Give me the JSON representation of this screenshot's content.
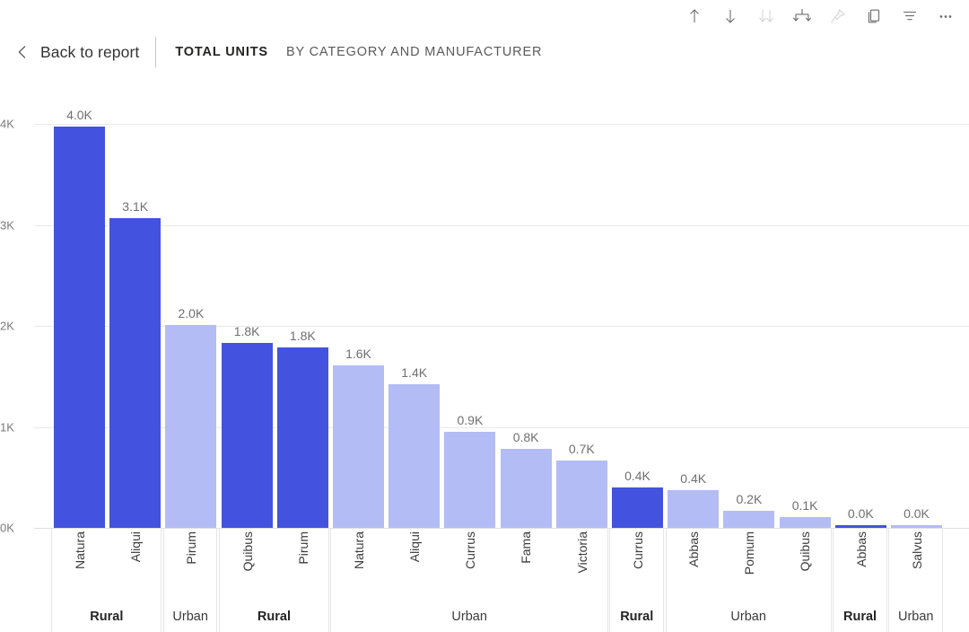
{
  "toolbar": {
    "buttons": [
      {
        "name": "sort-ascending-icon",
        "label": "Sort ascending",
        "dim": false
      },
      {
        "name": "sort-descending-icon",
        "label": "Sort descending",
        "dim": false
      },
      {
        "name": "drill-down-icon",
        "label": "Drill down",
        "dim": true
      },
      {
        "name": "expand-all-icon",
        "label": "Expand all down one level",
        "dim": false
      },
      {
        "name": "pin-icon",
        "label": "Pin visual",
        "dim": true
      },
      {
        "name": "copy-icon",
        "label": "Copy visual",
        "dim": false
      },
      {
        "name": "filter-icon",
        "label": "Filters",
        "dim": false
      },
      {
        "name": "more-options-icon",
        "label": "More options",
        "dim": false
      }
    ]
  },
  "header": {
    "back_label": "Back to report",
    "title_strong": "TOTAL UNITS",
    "title_light": "BY CATEGORY AND MANUFACTURER"
  },
  "colors": {
    "bar_dark": "#4353e0",
    "bar_light": "#b3bcf5",
    "gridline": "#eaeaea",
    "axis_text": "#7a7a7a"
  },
  "chart_data": {
    "type": "bar",
    "title": "TOTAL UNITS BY CATEGORY AND MANUFACTURER",
    "xlabel": "",
    "ylabel": "",
    "ylim": [
      0,
      4000
    ],
    "yticks": [
      "0K",
      "1K",
      "2K",
      "3K",
      "4K"
    ],
    "ytick_values": [
      0,
      1000,
      2000,
      3000,
      4000
    ],
    "grid": true,
    "legend": "none",
    "categories": [
      "Natura",
      "Aliqui",
      "Pirum",
      "Quibus",
      "Pirum",
      "Natura",
      "Aliqui",
      "Currus",
      "Fama",
      "Victoria",
      "Currus",
      "Abbas",
      "Pomum",
      "Quibus",
      "Abbas",
      "Salvus"
    ],
    "values": [
      3970,
      3070,
      2010,
      1830,
      1790,
      1610,
      1420,
      950,
      780,
      670,
      400,
      370,
      170,
      110,
      15,
      10
    ],
    "labels": [
      "4.0K",
      "3.1K",
      "2.0K",
      "1.8K",
      "1.8K",
      "1.6K",
      "1.4K",
      "0.9K",
      "0.8K",
      "0.7K",
      "0.4K",
      "0.4K",
      "0.2K",
      "0.1K",
      "0.0K",
      "0.0K"
    ],
    "series_of": [
      "Rural",
      "Rural",
      "Urban",
      "Rural",
      "Rural",
      "Urban",
      "Urban",
      "Urban",
      "Urban",
      "Urban",
      "Rural",
      "Urban",
      "Urban",
      "Urban",
      "Rural",
      "Urban"
    ],
    "groups": [
      {
        "name": "Rural",
        "count": 2
      },
      {
        "name": "Urban",
        "count": 1
      },
      {
        "name": "Rural",
        "count": 2
      },
      {
        "name": "Urban",
        "count": 5
      },
      {
        "name": "Rural",
        "count": 1
      },
      {
        "name": "Urban",
        "count": 3
      },
      {
        "name": "Rural",
        "count": 1
      },
      {
        "name": "Urban",
        "count": 1
      }
    ]
  }
}
